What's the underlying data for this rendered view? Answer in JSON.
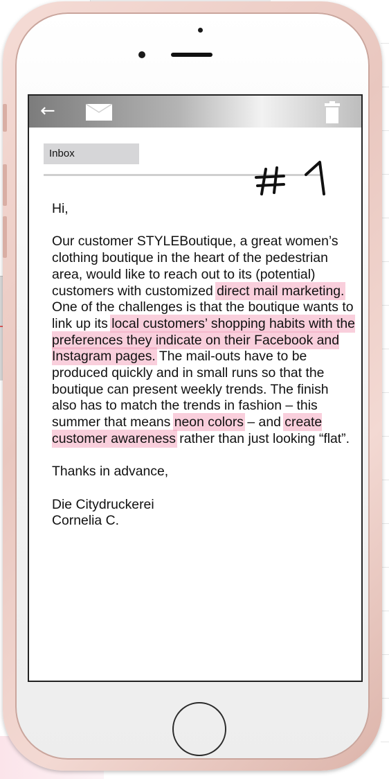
{
  "toolbar": {
    "back_icon": "←",
    "icons": [
      "back-arrow-icon",
      "mail-icon",
      "trash-icon"
    ]
  },
  "mailbox": {
    "folder_label": "Inbox",
    "annotation": "#1"
  },
  "email": {
    "greeting": "Hi,",
    "body": [
      {
        "text": "Our customer STYLEBoutique, a great women’s clothing boutique in the heart of the pedestrian area, would like to reach out to its (potential) customers with customized ",
        "highlight": false
      },
      {
        "text": "direct mail marketing.",
        "highlight": true
      },
      {
        "text": " One of the challenges is that the boutique wants to link up its ",
        "highlight": false
      },
      {
        "text": "local customers’ shopping habits with the preferences they indicate on their Facebook and Instagram pages.",
        "highlight": true
      },
      {
        "text": " The mail-outs have to be produced quickly and in small runs so that the boutique can present weekly trends. The finish also has to match the trends in fashion – this summer that means ",
        "highlight": false
      },
      {
        "text": "neon colors",
        "highlight": true
      },
      {
        "text": " – and ",
        "highlight": false
      },
      {
        "text": "create customer awareness",
        "highlight": true
      },
      {
        "text": " rather than just looking “flat”.",
        "highlight": false
      }
    ],
    "closing": "Thanks in advance,",
    "sender_company": "Die Citydruckerei",
    "sender_name": "Cornelia C."
  },
  "colors": {
    "highlight": "#f4a8c0",
    "phone_frame": "#e9c7bf",
    "toolbar_dark": "#7c7c7c"
  }
}
